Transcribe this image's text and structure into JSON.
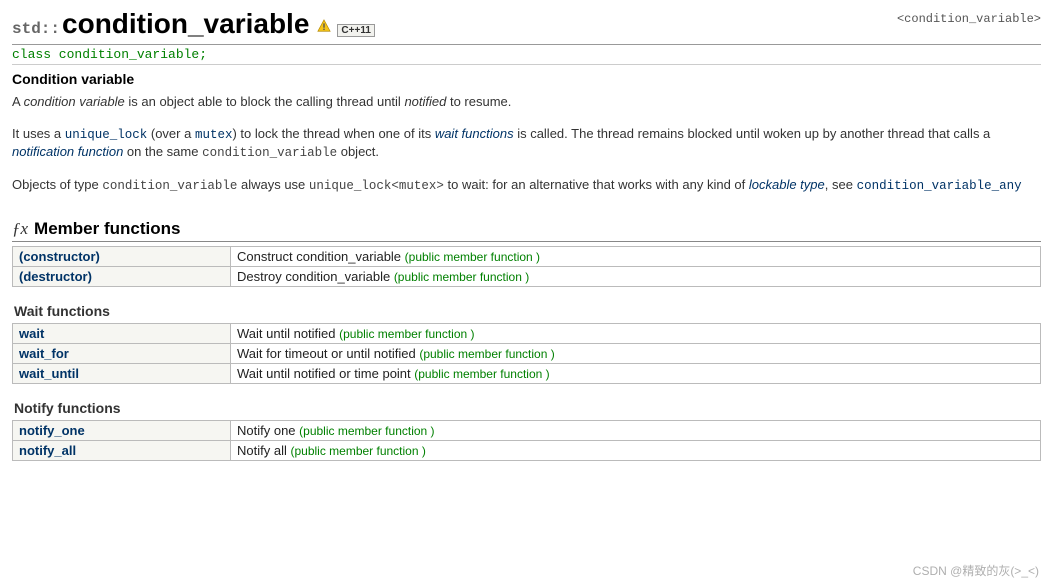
{
  "header": {
    "namespace": "std::",
    "title": "condition_variable",
    "cpp_badge": "C++11",
    "include": "<condition_variable>"
  },
  "declaration": "class condition_variable;",
  "intro_title": "Condition variable",
  "intro": {
    "p1a": "A ",
    "p1_em": "condition variable",
    "p1b": " is an object able to block the calling thread until ",
    "p1_notified": "notified",
    "p1c": " to resume.",
    "p2a": "It uses a ",
    "p2_unique_lock": "unique_lock",
    "p2b": " (over a ",
    "p2_mutex": "mutex",
    "p2c": ") to lock the thread when one of its ",
    "p2_waitfns": "wait functions",
    "p2d": " is called. The thread remains blocked until woken up by another thread that calls a ",
    "p2_notifn": "notification function",
    "p2e": " on the same ",
    "p2_cv": "condition_variable",
    "p2f": " object.",
    "p3a": "Objects of type ",
    "p3_cv": "condition_variable",
    "p3b": " always use ",
    "p3_ul": "unique_lock<mutex>",
    "p3c": " to wait: for an alternative that works with any kind of ",
    "p3_lockable": "lockable type",
    "p3d": ", see ",
    "p3_cva": "condition_variable_any"
  },
  "members_heading": "Member functions",
  "wait_heading": "Wait functions",
  "notify_heading": "Notify functions",
  "member_tag": "(public member function )",
  "tables": {
    "member": [
      {
        "name": "(constructor)",
        "desc": "Construct condition_variable "
      },
      {
        "name": "(destructor)",
        "desc": "Destroy condition_variable "
      }
    ],
    "wait": [
      {
        "name": "wait",
        "desc": "Wait until notified "
      },
      {
        "name": "wait_for",
        "desc": "Wait for timeout or until notified "
      },
      {
        "name": "wait_until",
        "desc": "Wait until notified or time point "
      }
    ],
    "notify": [
      {
        "name": "notify_one",
        "desc": "Notify one "
      },
      {
        "name": "notify_all",
        "desc": "Notify all "
      }
    ]
  },
  "watermark": "CSDN @精致的灰(>_<)"
}
